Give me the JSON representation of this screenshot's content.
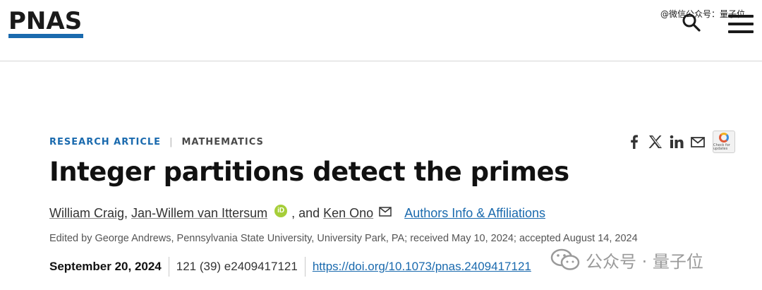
{
  "header": {
    "logo": "PNAS",
    "watermark": "@微信公众号：量子位",
    "icons": {
      "search": "search-icon",
      "menu": "hamburger-menu-icon"
    }
  },
  "article": {
    "type": "RESEARCH ARTICLE",
    "separator": "|",
    "subject": "MATHEMATICS",
    "title": "Integer partitions detect the primes",
    "authors": {
      "author1": "William Craig",
      "sep1": ",",
      "author2": "Jan-Willem van Ittersum",
      "orcid": "iD",
      "and": ", and",
      "author3": "Ken Ono",
      "affiliations_link": "Authors Info & Affiliations"
    },
    "edited_line": "Edited by George Andrews, Pennsylvania State University, University Park, PA; received May 10, 2024; accepted August 14, 2024",
    "date": "September 20, 2024",
    "issue": "121 (39) e2409417121",
    "doi": "https://doi.org/10.1073/pnas.2409417121"
  },
  "share": {
    "icons": [
      "facebook-icon",
      "x-icon",
      "linkedin-icon",
      "email-icon"
    ],
    "check_updates": "Check for updates"
  },
  "overlay_watermark": "公众号 · 量子位",
  "colors": {
    "brand_blue": "#1a6aae",
    "orcid_green": "#a6ce39"
  }
}
